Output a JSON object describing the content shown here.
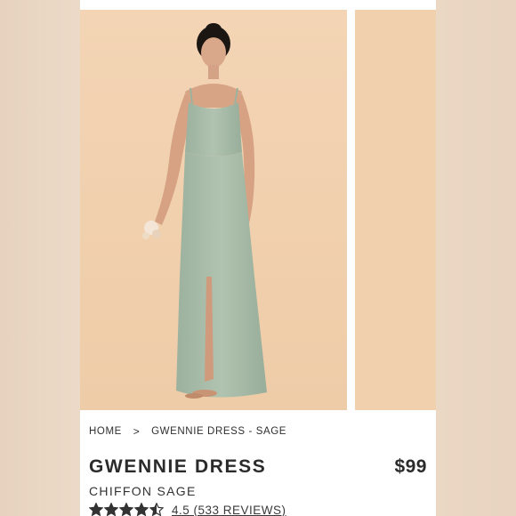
{
  "breadcrumb": {
    "home": "HOME",
    "separator": ">",
    "current": "GWENNIE DRESS - SAGE"
  },
  "product": {
    "name": "GWENNIE DRESS",
    "variant": "CHIFFON SAGE",
    "price": "$99",
    "rating": 4.5,
    "rating_text": "4.5 (533 REVIEWS)",
    "star_color": "#333333"
  },
  "images": {
    "main": "model-in-sage-dress-photo",
    "next": "next-gallery-photo"
  },
  "colors": {
    "photo_background": "#f2d2b1",
    "dress": "#a8bca8",
    "text": "#2b2b2b"
  }
}
